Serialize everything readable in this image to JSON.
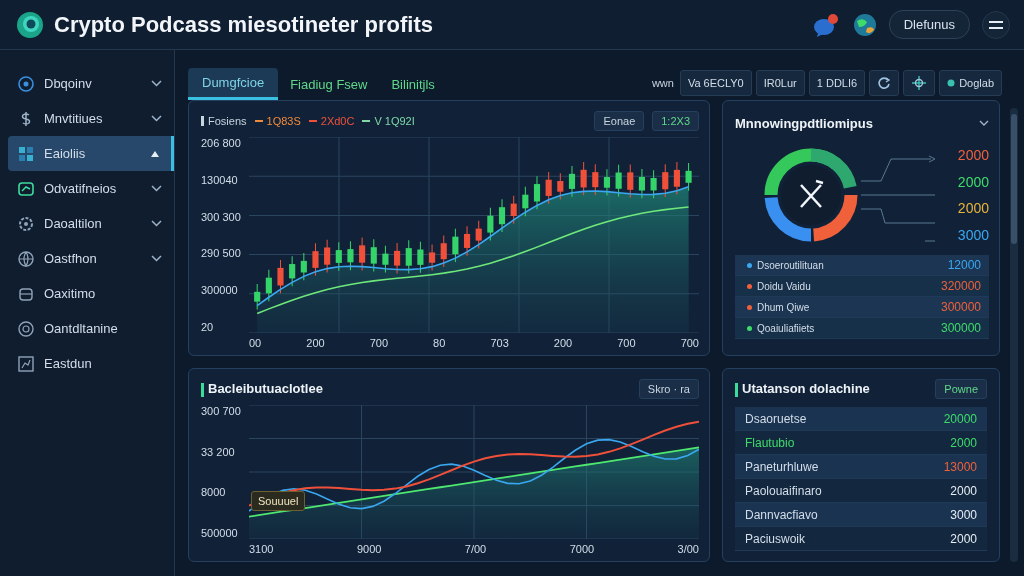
{
  "header": {
    "title": "Crypto Podcass miesotineter profits",
    "button": "Dlefunus"
  },
  "sidebar": {
    "items": [
      {
        "label": "Dbqoinv",
        "selected": false,
        "chevron": true
      },
      {
        "label": "Mnvtitiues",
        "selected": false,
        "chevron": true
      },
      {
        "label": "Eaioliis",
        "selected": true,
        "chevron": false
      },
      {
        "label": "Odvatifneios",
        "selected": false,
        "chevron": true
      },
      {
        "label": "Daoaltilon",
        "selected": false,
        "chevron": true
      },
      {
        "label": "Oastfhon",
        "selected": false,
        "chevron": true
      },
      {
        "label": "Oaxitimo",
        "selected": false,
        "chevron": false
      },
      {
        "label": "Oantdltanine",
        "selected": false,
        "chevron": false
      },
      {
        "label": "Eastdun",
        "selected": false,
        "chevron": false
      }
    ]
  },
  "tabs": [
    {
      "label": "Dumgfcioe",
      "selected": true
    },
    {
      "label": "Fiadiug Fsew",
      "selected": false
    },
    {
      "label": "Bilinitjls",
      "selected": false
    }
  ],
  "toolbar": [
    {
      "kind": "text",
      "label": "wwn"
    },
    {
      "kind": "button",
      "label": "Va 6ECLY0",
      "icon": false
    },
    {
      "kind": "button",
      "label": "IR0Lur",
      "icon": false
    },
    {
      "kind": "button",
      "label": "1 DDLI6",
      "icon": false
    },
    {
      "kind": "icon"
    },
    {
      "kind": "icon"
    },
    {
      "kind": "button",
      "label": "Doglab",
      "icon": true
    }
  ],
  "price_chart": {
    "legend": [
      {
        "text": "Fosiens",
        "color": "#c8d4e0"
      },
      {
        "text": "1Q83S",
        "color": "#f08a3a"
      },
      {
        "text": "2Xd0C",
        "color": "#f0503a"
      },
      {
        "text": "V 1Q92I",
        "color": "#7fd8a8"
      }
    ],
    "buttons": [
      "Eonae",
      "1:2X3"
    ],
    "y_labels": [
      "206 800",
      "130040",
      "300 300",
      "290 500",
      "300000",
      "20"
    ],
    "x_labels": [
      "00",
      "200",
      "700",
      "80",
      "703",
      "200",
      "700",
      "700"
    ]
  },
  "allocation": {
    "title": "Mnnowingpdtliomipus",
    "values": [
      {
        "text": "2000",
        "color": "#f0603a"
      },
      {
        "text": "2000",
        "color": "#3ddc6a"
      },
      {
        "text": "2000",
        "color": "#e8b43a"
      },
      {
        "text": "3000",
        "color": "#3aa8f0"
      }
    ],
    "rows": [
      {
        "name": "Dsoeroutilituan",
        "value": "12000",
        "color": "#3aa8f0"
      },
      {
        "name": "Doidu Vaidu",
        "value": "320000",
        "color": "#f0603a"
      },
      {
        "name": "Dhum Qiwe",
        "value": "300000",
        "color": "#f0603a"
      },
      {
        "name": "Qoaiuliafiiets",
        "value": "300000",
        "color": "#3ddc6a"
      }
    ]
  },
  "performance": {
    "title": "Bacleibutuaclotlee",
    "button": "Skro · ra",
    "tooltip": "Souuuel",
    "y_labels": [
      "300 700",
      "33 200",
      "8000",
      "500000"
    ],
    "x_labels": [
      "3100",
      "9000",
      "7/00",
      "7000",
      "3/00"
    ]
  },
  "holdings": {
    "title": "Utatanson dolachine",
    "button": "Powne",
    "rows": [
      {
        "name": "Dsaoruetse",
        "value": "20000",
        "color": "#3ddc6a",
        "accent": false
      },
      {
        "name": "Flautubio",
        "value": "2000",
        "color": "#3ddc6a",
        "accent": true
      },
      {
        "name": "Paneturhluwe",
        "value": "13000",
        "color": "#f0603a",
        "accent": false
      },
      {
        "name": "Paolouaifinaro",
        "value": "2000",
        "color": "#e6edf5",
        "accent": false
      },
      {
        "name": "Dannvacfiavo",
        "value": "3000",
        "color": "#e6edf5",
        "accent": false
      },
      {
        "name": "Paciuswoik",
        "value": "2000",
        "color": "#e6edf5",
        "accent": false
      }
    ]
  }
}
